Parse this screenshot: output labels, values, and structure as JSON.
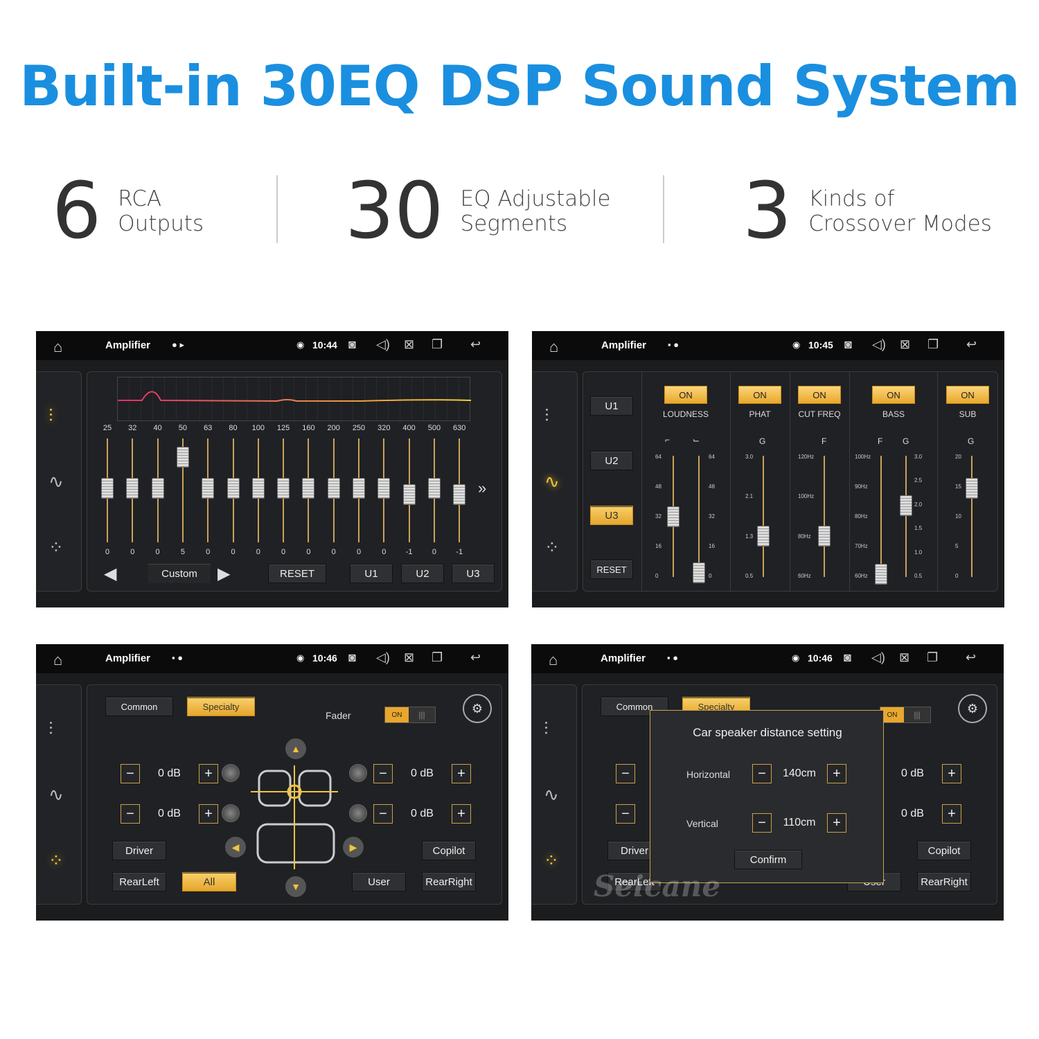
{
  "headline": "Built-in 30EQ DSP Sound System",
  "stats": [
    {
      "number": "6",
      "line1": "RCA",
      "line2": "Outputs"
    },
    {
      "number": "30",
      "line1": "EQ Adjustable",
      "line2": "Segments"
    },
    {
      "number": "3",
      "line1": "Kinds of",
      "line2": "Crossover Modes"
    }
  ],
  "colors": {
    "headline": "#1a8fe0",
    "accent": "#f3c43d",
    "screen_bg": "#1b1c1e"
  },
  "screens": [
    {
      "app": "Amplifier",
      "time": "10:44",
      "icons": "shield play"
    },
    {
      "app": "Amplifier",
      "time": "10:45",
      "icons": "image shield"
    },
    {
      "app": "Amplifier",
      "time": "10:46",
      "icons": "image shield"
    },
    {
      "app": "Amplifier",
      "time": "10:46",
      "icons": "image shield"
    }
  ],
  "eq": {
    "freqs": [
      "25",
      "32",
      "40",
      "50",
      "63",
      "80",
      "100",
      "125",
      "160",
      "200",
      "250",
      "320",
      "400",
      "500",
      "630"
    ],
    "values": [
      "0",
      "0",
      "0",
      "5",
      "0",
      "0",
      "0",
      "0",
      "0",
      "0",
      "0",
      "0",
      "-1",
      "0",
      "-1"
    ],
    "preset": "Custom",
    "reset": "RESET",
    "u1": "U1",
    "u2": "U2",
    "u3": "U3"
  },
  "crossover": {
    "u1": "U1",
    "u2": "U2",
    "u3": "U3",
    "reset": "RESET",
    "on": "ON",
    "groups": [
      "LOUDNESS",
      "PHAT",
      "CUT FREQ",
      "BASS",
      "SUB"
    ],
    "loud_scale": [
      "64",
      "48",
      "32",
      "16",
      "0"
    ],
    "phat_label": "G",
    "phat_scale": [
      "3.0",
      "2.1",
      "1.3",
      "0.5"
    ],
    "cut_label": "F",
    "cut_scale": [
      "120Hz",
      "100Hz",
      "80Hz",
      "60Hz"
    ],
    "bass_f": "F",
    "bass_g": "G",
    "bass_fscale": [
      "100Hz",
      "90Hz",
      "80Hz",
      "70Hz",
      "60Hz"
    ],
    "bass_gscale": [
      "3.0",
      "2.5",
      "2.0",
      "1.5",
      "1.0",
      "0.5"
    ],
    "sub_label": "G",
    "sub_scale": [
      "20",
      "15",
      "10",
      "5",
      "0"
    ]
  },
  "fader": {
    "common": "Common",
    "specialty": "Specialty",
    "fader": "Fader",
    "toggle_on": "ON",
    "toggle_off": "|||",
    "db": "0 dB",
    "driver": "Driver",
    "copilot": "Copilot",
    "rearleft": "RearLeft",
    "all": "All",
    "user": "User",
    "rearright": "RearRight"
  },
  "dialog": {
    "title": "Car speaker distance setting",
    "horizontal": "Horizontal",
    "h_val": "140cm",
    "vertical": "Vertical",
    "v_val": "110cm",
    "confirm": "Confirm",
    "watermark": "Seicane"
  }
}
